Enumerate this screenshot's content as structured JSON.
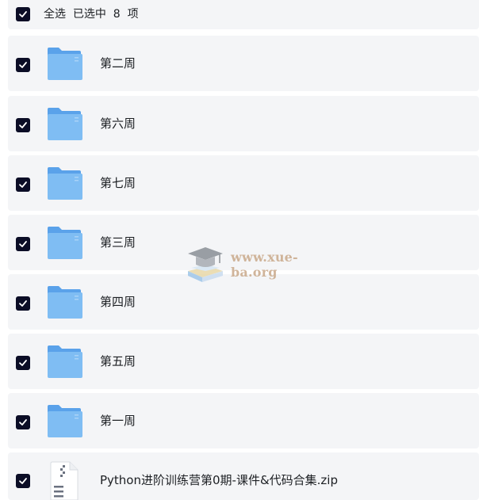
{
  "header": {
    "select_all_checked": true,
    "text": "全选  已选中  8  项"
  },
  "items": [
    {
      "type": "folder",
      "name": "第二周",
      "checked": true
    },
    {
      "type": "folder",
      "name": "第六周",
      "checked": true
    },
    {
      "type": "folder",
      "name": "第七周",
      "checked": true
    },
    {
      "type": "folder",
      "name": "第三周",
      "checked": true
    },
    {
      "type": "folder",
      "name": "第四周",
      "checked": true
    },
    {
      "type": "folder",
      "name": "第五周",
      "checked": true
    },
    {
      "type": "folder",
      "name": "第一周",
      "checked": true
    },
    {
      "type": "zip",
      "name": "Python进阶训练营第0期-课件&代码合集.zip",
      "checked": true
    }
  ],
  "watermark": {
    "text": "www.xue-ba.org"
  },
  "colors": {
    "checkbox": "#0b0d26",
    "row_bg": "#f4f5f7",
    "folder_front": "#7fbdf3",
    "folder_back": "#5aa2ea",
    "watermark": "#c9a98a"
  },
  "icons": {
    "checkbox": "check-icon",
    "folder": "folder-icon",
    "zip": "zip-file-icon",
    "watermark_logo": "graduation-cap-icon"
  }
}
